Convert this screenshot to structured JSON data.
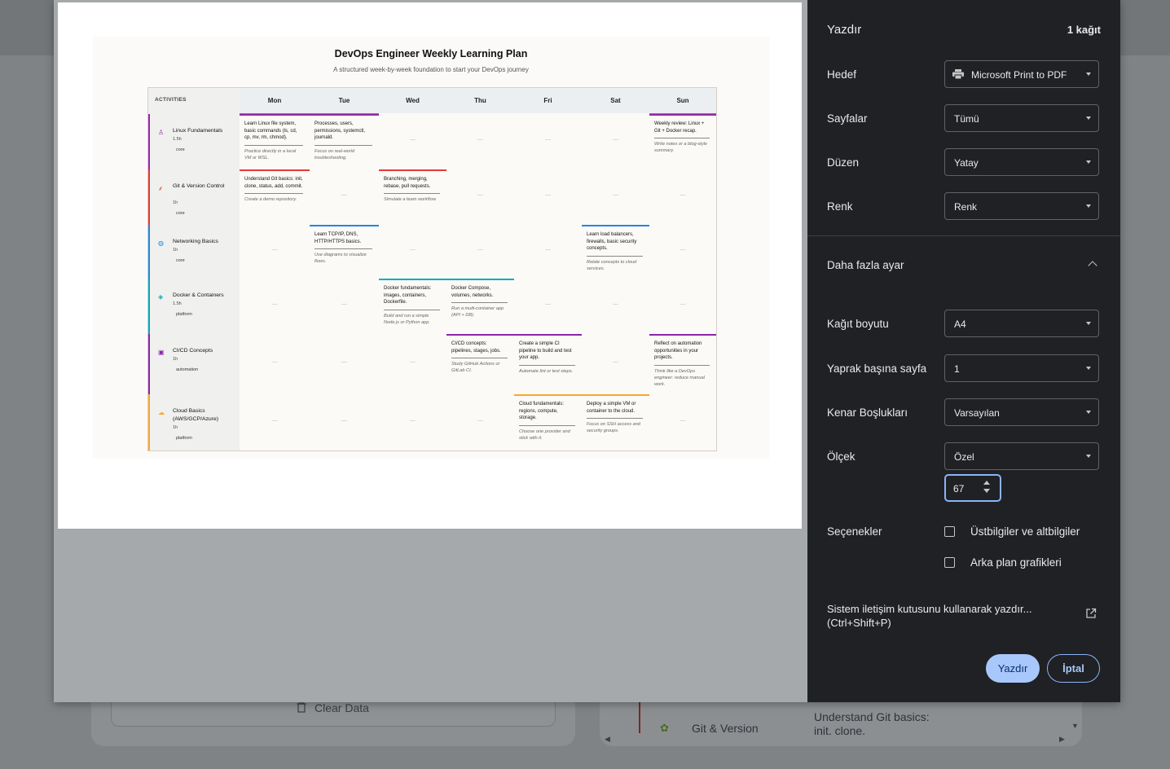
{
  "background": {
    "clear_data_label": "Clear Data",
    "card_row_label": "Git & Version",
    "card_row_text": "Understand Git basics: init. clone."
  },
  "preview": {
    "title": "DevOps Engineer Weekly Learning Plan",
    "subtitle": "A structured week-by-week foundation to start your DevOps journey",
    "activities_header": "ACTIVITIES",
    "days": [
      "Mon",
      "Tue",
      "Wed",
      "Thu",
      "Fri",
      "Sat",
      "Sun"
    ],
    "rows": [
      {
        "name": "Linux Fundamentals",
        "hours": "1.5h",
        "tag": "core",
        "color": "#9c27b0"
      },
      {
        "name": "Git & Version Control",
        "hours": "1h",
        "tag": "core",
        "color": "#e53935"
      },
      {
        "name": "Networking Basics",
        "hours": "1h",
        "tag": "core",
        "color": "#1e88e5"
      },
      {
        "name": "Docker & Containers",
        "hours": "1.5h",
        "tag": "platform",
        "color": "#00acc1"
      },
      {
        "name": "CI/CD Concepts",
        "hours": "1h",
        "tag": "automation",
        "color": "#8e24aa"
      },
      {
        "name": "Cloud Basics (AWS/GCP/Azure)",
        "hours": "1h",
        "tag": "platform",
        "color": "#f9a825"
      }
    ],
    "empty_mark": "—",
    "cells": {
      "r0_mon": {
        "main": "Learn Linux file system, basic commands (ls, cd, cp, mv, rm, chmod).",
        "note": "Practice directly in a local VM or WSL."
      },
      "r0_tue": {
        "main": "Processes, users, permissions, systemctl, journald.",
        "note": "Focus on real-world troubleshooting."
      },
      "r0_sun": {
        "main": "Weekly review: Linux + Git + Docker recap.",
        "note": "Write notes or a blog-style summary."
      },
      "r1_mon": {
        "main": "Understand Git basics: init, clone, status, add, commit.",
        "note": "Create a demo repository."
      },
      "r1_wed": {
        "main": "Branching, merging, rebase, pull requests.",
        "note": "Simulate a team workflow."
      },
      "r2_tue": {
        "main": "Learn TCP/IP, DNS, HTTP/HTTPS basics.",
        "note": "Use diagrams to visualize flows."
      },
      "r2_sat": {
        "main": "Learn load balancers, firewalls, basic security concepts.",
        "note": "Relate concepts to cloud services."
      },
      "r3_wed": {
        "main": "Docker fundamentals: images, containers, Dockerfile.",
        "note": "Build and run a simple Node.js or Python app."
      },
      "r3_thu": {
        "main": "Docker Compose, volumes, networks.",
        "note": "Run a multi-container app (API + DB)."
      },
      "r4_thu": {
        "main": "CI/CD concepts: pipelines, stages, jobs.",
        "note": "Study GitHub Actions or GitLab CI."
      },
      "r4_fri": {
        "main": "Create a simple CI pipeline to build and test your app.",
        "note": "Automate lint or test steps."
      },
      "r4_sun": {
        "main": "Reflect on automation opportunities in your projects.",
        "note": "Think like a DevOps engineer: reduce manual work."
      },
      "r5_fri": {
        "main": "Cloud fundamentals: regions, compute, storage.",
        "note": "Choose one provider and stick with it."
      },
      "r5_sat": {
        "main": "Deploy a simple VM or container to the cloud.",
        "note": "Focus on SSH access and security groups."
      }
    }
  },
  "panel": {
    "title": "Yazdır",
    "sheet_count": "1 kağıt",
    "destination_label": "Hedef",
    "destination_value": "Microsoft Print to PDF",
    "pages_label": "Sayfalar",
    "pages_value": "Tümü",
    "layout_label": "Düzen",
    "layout_value": "Yatay",
    "color_label": "Renk",
    "color_value": "Renk",
    "more_settings": "Daha fazla ayar",
    "paper_size_label": "Kağıt boyutu",
    "paper_size_value": "A4",
    "pages_per_sheet_label": "Yaprak başına sayfa",
    "pages_per_sheet_value": "1",
    "margins_label": "Kenar Boşlukları",
    "margins_value": "Varsayılan",
    "scale_label": "Ölçek",
    "scale_value": "Özel",
    "scale_number": "67",
    "options_label": "Seçenekler",
    "option_headers": "Üstbilgiler ve altbilgiler",
    "option_background": "Arka plan grafikleri",
    "system_dialog": "Sistem iletişim kutusunu kullanarak yazdır... (Ctrl+Shift+P)",
    "print_button": "Yazdır",
    "cancel_button": "İptal"
  },
  "colors": {
    "accent": "#a8c7fa",
    "panel_bg": "#202124",
    "green": "#43a047"
  }
}
